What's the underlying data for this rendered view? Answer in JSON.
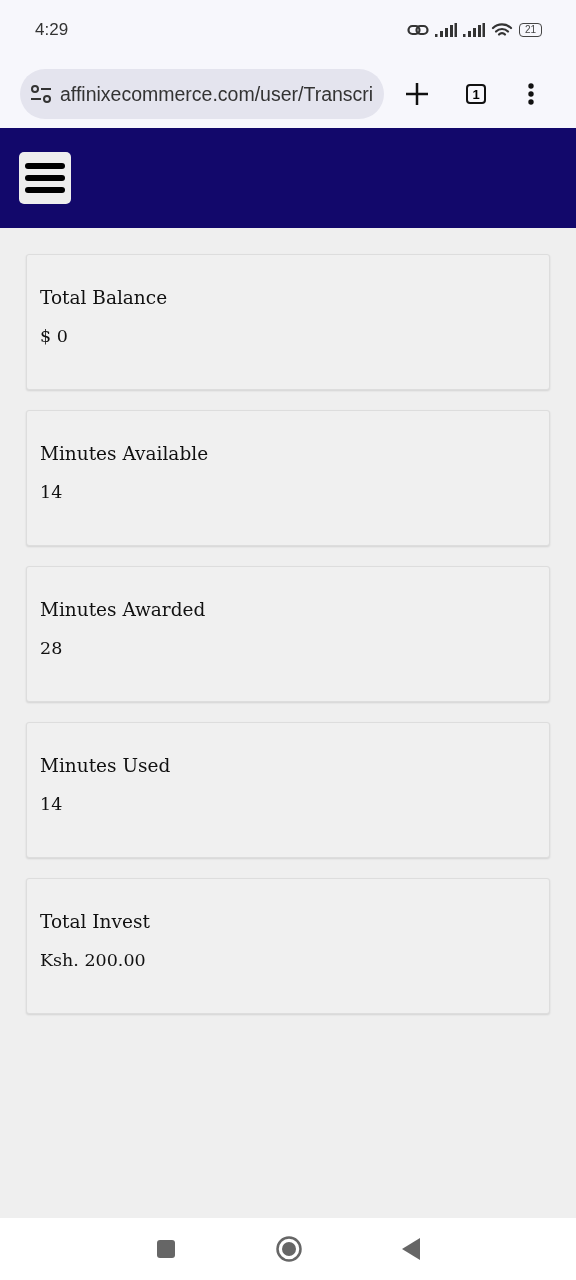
{
  "status_bar": {
    "time": "4:29",
    "battery": "21"
  },
  "browser": {
    "url": "affinixecommerce.com/user/Transcri",
    "tab_count": "1"
  },
  "cards": [
    {
      "label": "Total Balance",
      "value": "$ 0"
    },
    {
      "label": "Minutes Available",
      "value": "14"
    },
    {
      "label": "Minutes Awarded",
      "value": "28"
    },
    {
      "label": "Minutes Used",
      "value": "14"
    },
    {
      "label": "Total Invest",
      "value": "Ksh. 200.00"
    }
  ]
}
